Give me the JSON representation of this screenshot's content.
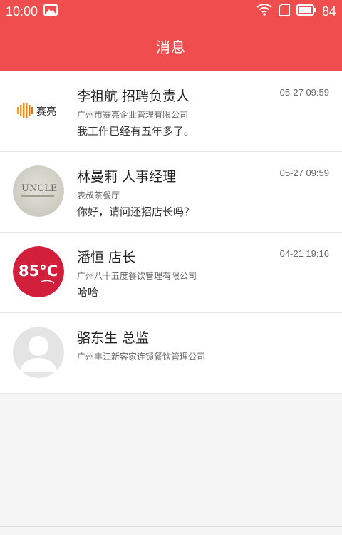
{
  "status_bar": {
    "time": "10:00",
    "battery": "84",
    "icons": [
      "image-icon",
      "wifi-icon",
      "sim-icon",
      "battery-icon"
    ]
  },
  "header": {
    "title": "消息",
    "color": "#f04d4f"
  },
  "messages": [
    {
      "name": "李祖航 招聘负责人",
      "company": "广州市赛亮企业管理有限公司",
      "text": "我工作已经有五年多了。",
      "time": "05-27 09:59",
      "avatar_logo": "赛亮"
    },
    {
      "name": "林曼莉 人事经理",
      "company": "表叔茶餐厅",
      "text": " 你好，请问还招店长吗？",
      "time": "05-27 09:59",
      "avatar_logo": "UNCLE"
    },
    {
      "name": "潘恒 店长",
      "company": "广州八十五度餐饮管理有限公司",
      "text": "哈哈",
      "time": "04-21 19:16",
      "avatar_logo": "85°C"
    },
    {
      "name": "骆东生 总监",
      "company": "广州丰江新客家连锁餐饮管理公司",
      "text": "",
      "time": "",
      "avatar_logo": ""
    }
  ]
}
